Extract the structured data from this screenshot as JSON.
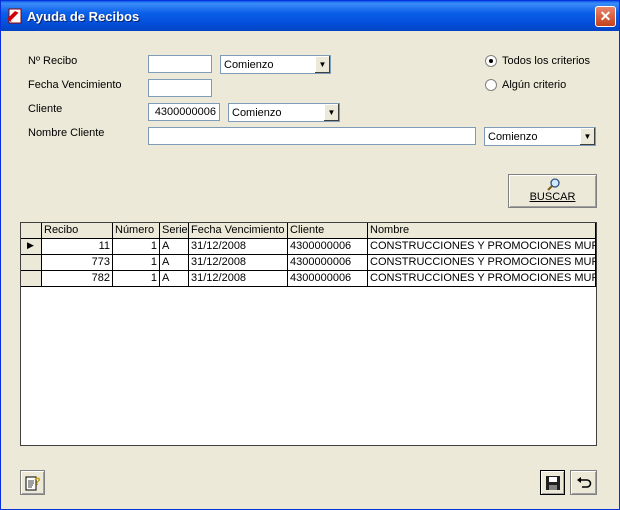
{
  "window": {
    "title": "Ayuda de Recibos",
    "close_label": "✕"
  },
  "form": {
    "recibo_label": "Nº Recibo",
    "recibo_value": "",
    "recibo_mode": "Comienzo",
    "fecha_label": "Fecha Vencimiento",
    "fecha_value": "",
    "cliente_label": "Cliente",
    "cliente_value": "4300000006",
    "cliente_mode": "Comienzo",
    "nombre_label": "Nombre Cliente",
    "nombre_value": "",
    "nombre_mode": "Comienzo"
  },
  "criteria": {
    "todos_label": "Todos los criterios",
    "algun_label": "Algún criterio",
    "selected": "todos"
  },
  "search_button": {
    "label": "BUSCAR",
    "accel": "B"
  },
  "grid": {
    "columns": [
      "Recibo",
      "Número",
      "Serie",
      "Fecha Vencimiento",
      "Cliente",
      "Nombre"
    ],
    "rows": [
      [
        "11",
        "1",
        "A",
        "31/12/2008",
        "4300000006",
        "CONSTRUCCIONES Y PROMOCIONES MURI"
      ],
      [
        "773",
        "1",
        "A",
        "31/12/2008",
        "4300000006",
        "CONSTRUCCIONES Y PROMOCIONES MURI"
      ],
      [
        "782",
        "1",
        "A",
        "31/12/2008",
        "4300000006",
        "CONSTRUCCIONES Y PROMOCIONES MURI"
      ]
    ],
    "current_row_indicator": "▶"
  },
  "icons": {
    "title": "app-icon",
    "help": "help-icon",
    "save": "save-icon",
    "undo": "undo-icon",
    "search": "magnifier-icon"
  }
}
